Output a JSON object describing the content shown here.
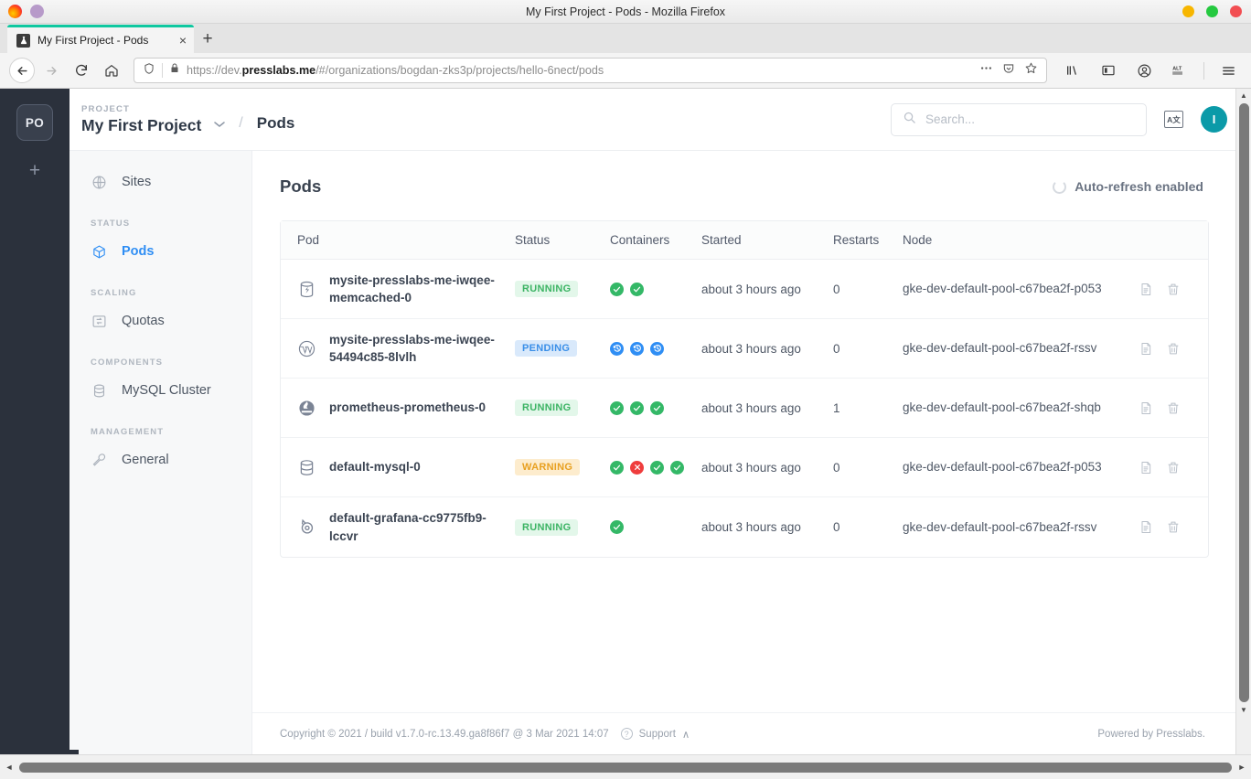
{
  "browser": {
    "window_title": "My First Project - Pods - Mozilla Firefox",
    "tab": {
      "title": "My First Project - Pods",
      "close_label": "×"
    },
    "new_tab_label": "+",
    "url": {
      "scheme": "https://dev.",
      "domain": "presslabs.me",
      "path": "/#/organizations/bogdan-zks3p/projects/hello-6nect/pods"
    },
    "nav": {
      "back": "←",
      "forward": "→",
      "reload": "↻",
      "home": "⌂"
    },
    "toolbar_icons": [
      "library-icon",
      "sidebar-icon",
      "account-icon",
      "alt-extension-icon",
      "menu-icon"
    ],
    "extension_label": "ALT",
    "window_buttons": [
      "minimize",
      "maximize",
      "close"
    ]
  },
  "org_rail": {
    "avatar_initials": "PO",
    "add_label": "+"
  },
  "header": {
    "project_kicker": "PROJECT",
    "project_name": "My First Project",
    "breadcrumb_separator": "/",
    "breadcrumb_current": "Pods",
    "search_placeholder": "Search...",
    "search_value": "",
    "translate_label": "A文",
    "user_initial": "I"
  },
  "sidebar": {
    "items": [
      {
        "label": "Sites",
        "icon": "globe-icon",
        "active": false,
        "group": null
      },
      {
        "label": "Pods",
        "icon": "cube-icon",
        "active": true,
        "group": "STATUS"
      },
      {
        "label": "Quotas",
        "icon": "quota-icon",
        "active": false,
        "group": "SCALING"
      },
      {
        "label": "MySQL Cluster",
        "icon": "database-icon",
        "active": false,
        "group": "COMPONENTS"
      },
      {
        "label": "General",
        "icon": "wrench-icon",
        "active": false,
        "group": "MANAGEMENT"
      }
    ],
    "groups": [
      "STATUS",
      "SCALING",
      "COMPONENTS",
      "MANAGEMENT"
    ]
  },
  "main": {
    "title": "Pods",
    "auto_refresh_label": "Auto-refresh enabled",
    "table": {
      "columns": [
        "Pod",
        "Status",
        "Containers",
        "Started",
        "Restarts",
        "Node"
      ],
      "rows": [
        {
          "icon": "memcached-icon",
          "pod": "mysite-presslabs-me-iwqee-memcached-0",
          "status": "RUNNING",
          "status_kind": "running",
          "containers": [
            "ok",
            "ok"
          ],
          "started": "about 3 hours ago",
          "restarts": "0",
          "node": "gke-dev-default-pool-c67bea2f-p053"
        },
        {
          "icon": "wordpress-icon",
          "pod": "mysite-presslabs-me-iwqee-54494c85-8lvlh",
          "status": "PENDING",
          "status_kind": "pending",
          "containers": [
            "wait",
            "wait",
            "wait"
          ],
          "started": "about 3 hours ago",
          "restarts": "0",
          "node": "gke-dev-default-pool-c67bea2f-rssv"
        },
        {
          "icon": "prometheus-icon",
          "pod": "prometheus-prometheus-0",
          "status": "RUNNING",
          "status_kind": "running",
          "containers": [
            "ok",
            "ok",
            "ok"
          ],
          "started": "about 3 hours ago",
          "restarts": "1",
          "node": "gke-dev-default-pool-c67bea2f-shqb"
        },
        {
          "icon": "mysql-icon",
          "pod": "default-mysql-0",
          "status": "WARNING",
          "status_kind": "warning",
          "containers": [
            "ok",
            "err",
            "ok",
            "ok"
          ],
          "started": "about 3 hours ago",
          "restarts": "0",
          "node": "gke-dev-default-pool-c67bea2f-p053"
        },
        {
          "icon": "grafana-icon",
          "pod": "default-grafana-cc9775fb9-lccvr",
          "status": "RUNNING",
          "status_kind": "running",
          "containers": [
            "ok"
          ],
          "started": "about 3 hours ago",
          "restarts": "0",
          "node": "gke-dev-default-pool-c67bea2f-rssv"
        }
      ],
      "row_actions": [
        "logs-icon",
        "delete-icon"
      ]
    }
  },
  "footer": {
    "copyright": "Copyright © 2021 / build v1.7.0-rc.13.49.ga8f86f7 @ 3 Mar 2021 14:07",
    "support_label": "Support",
    "support_chevron": "∧",
    "powered_by": "Powered by Presslabs."
  },
  "colors": {
    "accent_blue": "#2f8ef4",
    "rail_dark": "#2b313c",
    "running_green": "#3cb464",
    "pending_blue": "#3a8fe8",
    "warning_amber": "#e8a020",
    "error_red": "#ef3d3d",
    "avatar_teal": "#0b9aa8",
    "tab_accent": "#0fc8a0"
  }
}
